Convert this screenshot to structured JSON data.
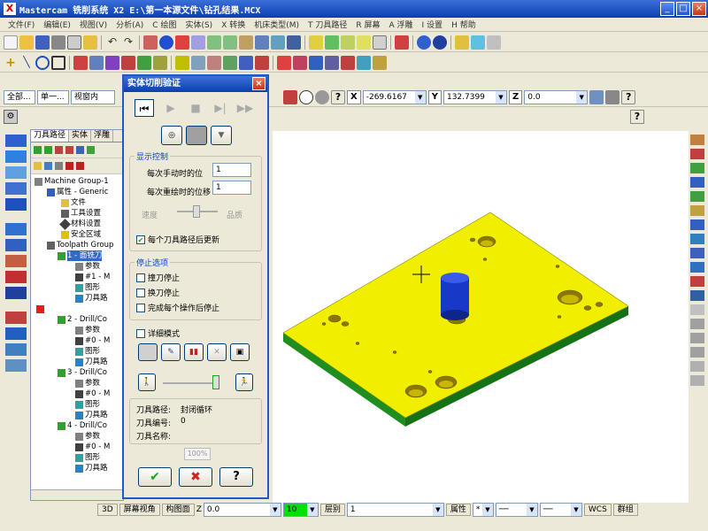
{
  "window": {
    "title": "Mastercam 铣削系统  X2  E:\\第一本源文件\\钻孔结果.MCX",
    "app_icon": "X"
  },
  "menu": [
    "文件(F)",
    "编辑(E)",
    "视图(V)",
    "分析(A)",
    "C 绘图",
    "实体(S)",
    "X 转换",
    "机床类型(M)",
    "T 刀具路径",
    "R 屏幕",
    "A 浮雕",
    "I 设置",
    "H 帮助"
  ],
  "toolbar3": {
    "all_label": "全部...",
    "single_label": "单一...",
    "viewport_label": "视窗内",
    "x_label": "X",
    "x_value": "-269.6167",
    "y_label": "Y",
    "y_value": "132.7399",
    "z_label": "Z",
    "z_value": "0.0"
  },
  "left_panel": {
    "tabs": [
      "刀具路径",
      "实体",
      "浮雕"
    ],
    "tree": [
      "Machine Group-1",
      "属性 - Generic",
      "文件",
      "工具设置",
      "材料设置",
      "安全区域",
      "Toolpath Group",
      "1 - 面铣刀",
      "参数",
      "#1 - M",
      "图形",
      "刀具路",
      "2 - Drill/Co",
      "参数",
      "#0 - M",
      "图形",
      "刀具路",
      "3 - Drill/Co",
      "参数",
      "#0 - M",
      "图形",
      "刀具路",
      "4 - Drill/Co",
      "参数",
      "#0 - M",
      "图形",
      "刀具路"
    ]
  },
  "dialog": {
    "title": "实体切削验证",
    "display_group": "显示控制",
    "per_manual_label": "每次手动时的位",
    "per_manual_value": "1",
    "per_redraw_label": "每次重绘时的位移",
    "per_redraw_value": "1",
    "speed_label": "速度",
    "quality_label": "品质",
    "update_each_path": "每个刀具路径后更新",
    "stop_group": "停止选项",
    "stop_collision": "撞刀停止",
    "stop_toolchange": "换刀停止",
    "stop_after_op": "完成每个操作后停止",
    "detail_mode": "详细模式",
    "toolpath_label": "刀具路径:",
    "toolpath_value": "封闭循环",
    "tool_number_label": "刀具编号:",
    "tool_number_value": "0",
    "tool_name_label": "刀具名称:",
    "tool_name_value": "",
    "progress": "100%"
  },
  "statusbar": {
    "mode": "3D",
    "screen_view": "屏幕视角",
    "plane": "构图面",
    "z_label": "Z",
    "z_value": "0.0",
    "color_value": "10",
    "level_label": "层别",
    "level_value": "1",
    "attr_label": "属性",
    "wcs": "WCS",
    "group": "群组"
  },
  "colors": {
    "part_top": "#f2ee00",
    "part_side": "#1e8f1e",
    "tool": "#1838c8",
    "title_blue": "#0a3fb0"
  }
}
